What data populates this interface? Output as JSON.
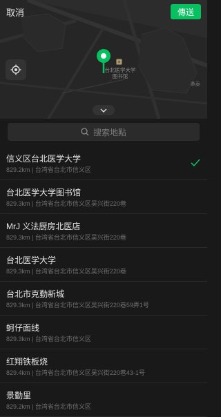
{
  "header": {
    "cancel_label": "取消",
    "send_label": "傳送"
  },
  "map": {
    "poi_label": "台北医学大学图书馆",
    "mark_text": "鼎泰",
    "accent": "#07c160"
  },
  "search": {
    "placeholder": "搜索地點"
  },
  "places": [
    {
      "name": "信义区台北医学大学",
      "addr": "829.2km | 台湾省台北市信义区",
      "selected": true
    },
    {
      "name": "台北医学大学图书馆",
      "addr": "829.3km | 台湾省台北市信义区吴兴街220巷"
    },
    {
      "name": "MrJ 义法厨房北医店",
      "addr": "829.3km | 台湾省台北市信义区吴兴街220巷"
    },
    {
      "name": "台北医学大学",
      "addr": "829.3km | 台湾省台北市信义区吴兴街220巷"
    },
    {
      "name": "台北市克勤新城",
      "addr": "829.3km | 台湾省台北市信义区吴兴街220巷59弄1号"
    },
    {
      "name": "蚵仔面线",
      "addr": "829.3km | 台湾省台北市信义区"
    },
    {
      "name": "红翔铁板烧",
      "addr": "829.4km | 台湾省台北市信义区吴兴街220巷43-1号"
    },
    {
      "name": "景勤里",
      "addr": "829.2km | 台湾省台北市信义区"
    }
  ]
}
